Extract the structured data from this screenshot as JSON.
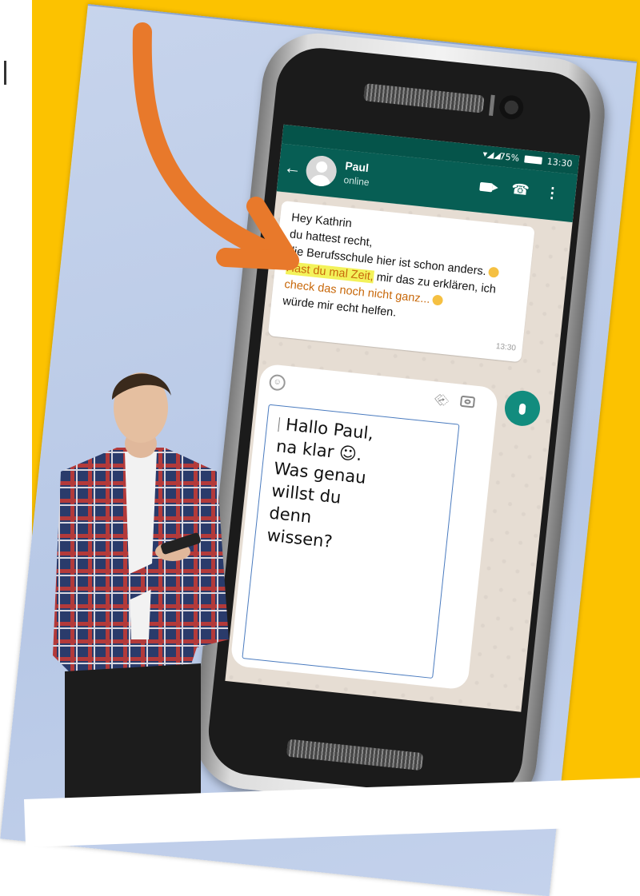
{
  "chat": {
    "status_bar": {
      "signal": "▾◢◢",
      "battery": "75%",
      "time": "13:30"
    },
    "header": {
      "back_icon": "←",
      "contact_name": "Paul",
      "contact_status": "online",
      "phone_icon": "☎",
      "menu_icon": "⋮"
    },
    "message": {
      "line1": "Hey Kathrin",
      "line2": "du hattest recht,",
      "line3": "die Berufsschule hier ist schon anders.",
      "line4_highlight": "Hast du mal Zeit,",
      "line4_rest": " mir das zu erklären, ich",
      "line5_orange": "check das noch nicht ganz...",
      "line6": "würde mir echt helfen.",
      "time": "13:30"
    },
    "input": {
      "smiley_icon": "☺",
      "attach_icon": "⎘"
    },
    "reply": {
      "line1": "Hallo Paul,",
      "line2": "na klar ☺.",
      "line3": "Was genau",
      "line4": "willst du",
      "line5": "denn",
      "line6": "wissen?"
    }
  },
  "colors": {
    "background_yellow": "#fcc200",
    "arrow_orange": "#e8792b",
    "whatsapp_teal": "#075e54",
    "mic_green": "#128c7e",
    "highlight_yellow": "#f3f25a"
  }
}
